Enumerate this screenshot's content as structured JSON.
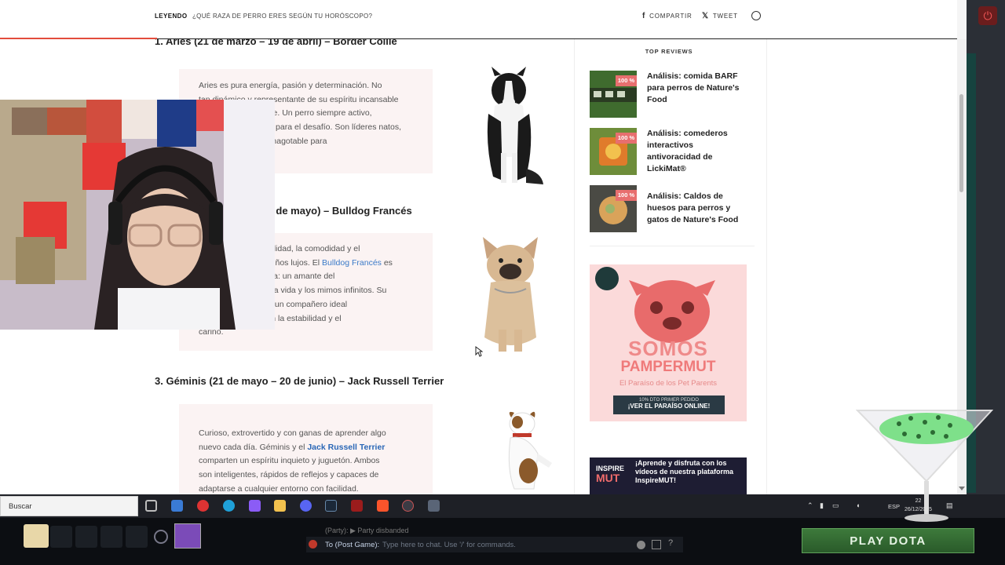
{
  "topbar": {
    "reading_label": "LEYENDO",
    "reading_title": "¿QUÉ RAZA DE PERRO ERES SEGÚN TU HORÓSCOPO?",
    "share_facebook": "COMPARTIR",
    "share_x": "TWEET"
  },
  "article": {
    "section1_heading": "1. Aries (21 de marzo – 19 de abril) – Border Collie",
    "section1_lines": [
      "Aries es pura energía, pasión y determinación. No",
      "tan dinámico y representante de su espíritu incansable",
      "como el Border Collie. Un perro siempre activo,",
      "listo para la acción y para el desafío. Son líderes natos,",
      "con una capacidad inagotable para",
      ""
    ],
    "section2_heading": "2. Tauro (20 de abril – 20 de mayo) – Bulldog Francés",
    "section2_lines": [
      "Tauro ama la tranquilidad, la comodidad y el",
      "disfrute de los pequeños lujos. El",
      "Bulldog Francés",
      "es su versión perruna: un amante del",
      "buen dormir, la buena vida y los mimos infinitos. Su",
      "carácter leal lo hace un compañero ideal",
      "para quienes valoran la estabilidad y el",
      "cariño."
    ],
    "section3_heading": "3. Géminis (21 de mayo – 20 de junio) – Jack Russell Terrier",
    "section3_lines": [
      "Curioso, extrovertido y con ganas de aprender algo",
      "nuevo cada día. Géminis y el",
      "Jack Russell Terrier",
      "comparten un espíritu inquieto y juguetón. Ambos",
      "son inteligentes, rápidos de reflejos y capaces de",
      "adaptarse a cualquier entorno con facilidad."
    ]
  },
  "sidebar": {
    "title": "TOP REVIEWS",
    "reviews": [
      {
        "badge": "100 %",
        "title": "Análisis: comida BARF para perros de Nature's Food"
      },
      {
        "badge": "100 %",
        "title": "Análisis: comederos interactivos antivoracidad de LickiMat®"
      },
      {
        "badge": "100 %",
        "title": "Análisis: Caldos de huesos para perros y gatos de Nature's Food"
      }
    ],
    "ad1": {
      "headline1": "SOMOS",
      "headline2": "PAMPERMUT",
      "tagline": "El Paraíso de los Pet Parents",
      "promo": "10% DTO PRIMER PEDIDO",
      "cta": "¡VER EL PARAÍSO ONLINE!"
    },
    "ad2": {
      "brand1": "INSPIRE",
      "brand2": "MUT",
      "text": "¡Aprende y disfruta con los vídeos de nuestra plataforma InspireMUT!"
    }
  },
  "taskbar": {
    "search_placeholder": "Buscar",
    "lang": "ESP",
    "time": "22",
    "date": "26/12/2025"
  },
  "game": {
    "party_status": "(Party): ▶ Party disbanded",
    "chat_target": "To (Post Game):",
    "chat_placeholder": "Type here to chat. Use '/' for commands.",
    "play_button": "PLAY DOTA"
  },
  "colors": {
    "accent_red": "#e34c3c",
    "link_blue": "#3b7ac8",
    "card_bg": "#fbf3f3",
    "play_green": "#3d7a3b"
  }
}
